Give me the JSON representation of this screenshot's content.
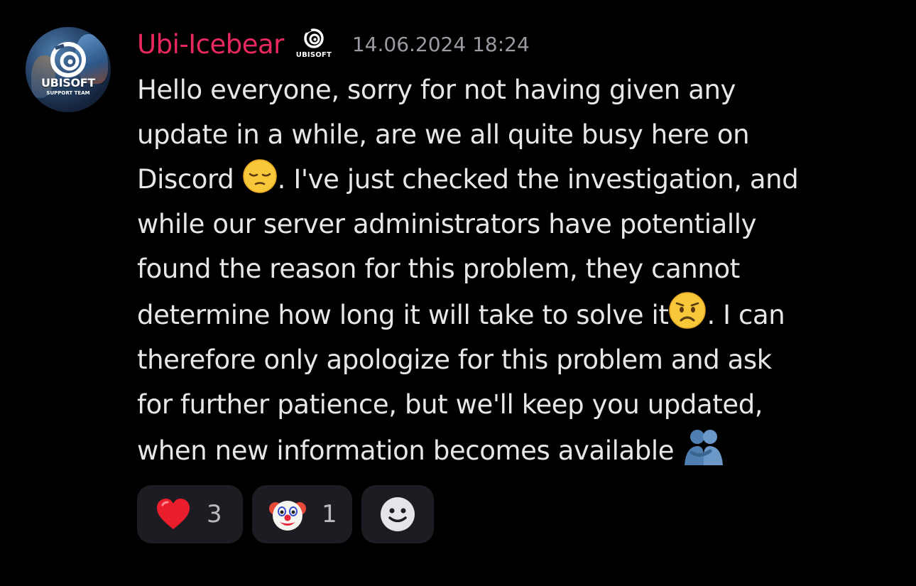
{
  "author": {
    "username": "Ubi-Icebear",
    "username_color": "#e9285f",
    "avatar": {
      "brand": "UBISOFT",
      "subtitle": "SUPPORT TEAM",
      "icon": "ubisoft-swirl-icon"
    },
    "server_tag": {
      "icon": "ubisoft-swirl-icon",
      "label": "UBISOFT"
    },
    "timestamp": "14.06.2024 18:24"
  },
  "message": {
    "lines": [
      "Hello everyone, sorry for not having given any",
      "update in a while, are we all quite busy here on",
      "Discord",
      ". I've just checked the investigation, and",
      "while our server administrators have potentially",
      "found the reason for this problem, they cannot",
      "determine how long it will take to solve it",
      ". I can",
      "therefore only apologize for this problem and ask",
      "for further patience, but we'll keep you updated,",
      "when new information becomes available"
    ],
    "inline_emojis": [
      "pensive-face-emoji",
      "worried-face-emoji",
      "people-hugging-emoji"
    ]
  },
  "reactions": [
    {
      "emoji": "red-heart-emoji",
      "count": "3"
    },
    {
      "emoji": "clown-face-emoji",
      "count": "1"
    },
    {
      "emoji": "add-reaction-icon"
    }
  ],
  "colors": {
    "background": "#000000",
    "text": "#e7e7ea",
    "timestamp": "#9a9ba2",
    "reaction_bg": "#1c1c22",
    "reaction_count": "#b9bac0"
  }
}
